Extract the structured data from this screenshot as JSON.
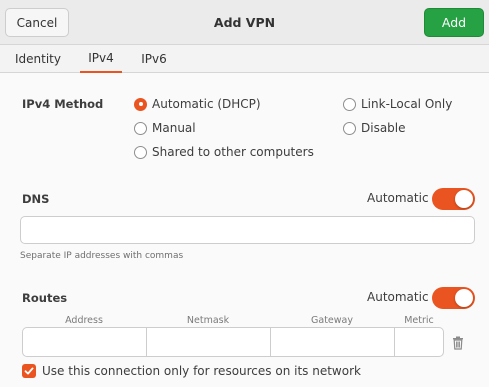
{
  "header": {
    "cancel_label": "Cancel",
    "title": "Add VPN",
    "add_label": "Add"
  },
  "tabs": [
    {
      "label": "Identity",
      "active": false
    },
    {
      "label": "IPv4",
      "active": true
    },
    {
      "label": "IPv6",
      "active": false
    }
  ],
  "ipv4_method": {
    "label": "IPv4 Method",
    "options": [
      {
        "label": "Automatic (DHCP)",
        "selected": true
      },
      {
        "label": "Manual",
        "selected": false
      },
      {
        "label": "Shared to other computers",
        "selected": false
      },
      {
        "label": "Link-Local Only",
        "selected": false
      },
      {
        "label": "Disable",
        "selected": false
      }
    ]
  },
  "dns": {
    "label": "DNS",
    "automatic_label": "Automatic",
    "automatic_on": true,
    "value": "",
    "hint": "Separate IP addresses with commas"
  },
  "routes": {
    "label": "Routes",
    "automatic_label": "Automatic",
    "automatic_on": true,
    "columns": [
      "Address",
      "Netmask",
      "Gateway",
      "Metric"
    ],
    "row": [
      "",
      "",
      "",
      ""
    ]
  },
  "only_local": {
    "label": "Use this connection only for resources on its network",
    "checked": true
  },
  "colors": {
    "accent": "#e95420",
    "add_button": "#26a143"
  }
}
